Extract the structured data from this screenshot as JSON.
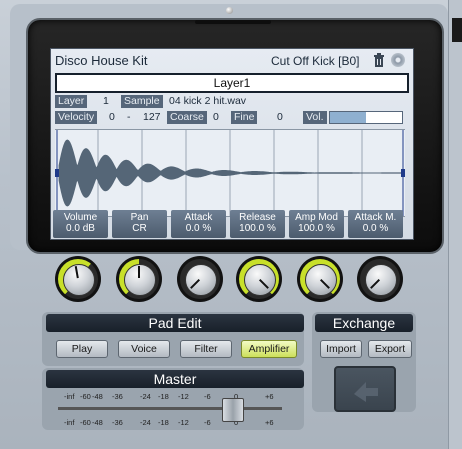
{
  "lcd": {
    "kit_name": "Disco House Kit",
    "preset_name": "Cut Off Kick [B0]",
    "layer_title": "Layer1",
    "layer_label": "Layer",
    "layer_value": "1",
    "sample_label": "Sample",
    "sample_value": "04 kick 2 hit.wav",
    "velocity_label": "Velocity",
    "velocity_low": "0",
    "velocity_dash": "-",
    "velocity_high": "127",
    "coarse_label": "Coarse",
    "coarse_value": "0",
    "fine_label": "Fine",
    "fine_value": "0",
    "vol_label": "Vol.",
    "vol_level": 0.5
  },
  "params": [
    {
      "name": "Volume",
      "value": "0.0 dB"
    },
    {
      "name": "Pan",
      "value": "CR"
    },
    {
      "name": "Attack",
      "value": "0.0 %"
    },
    {
      "name": "Release",
      "value": "100.0 %"
    },
    {
      "name": "Amp Mod",
      "value": "100.0 %"
    },
    {
      "name": "Attack M.",
      "value": "0.0 %"
    }
  ],
  "pad_edit": {
    "title": "Pad Edit",
    "buttons": [
      "Play",
      "Voice",
      "Filter",
      "Amplifier"
    ],
    "active": "Amplifier"
  },
  "exchange": {
    "title": "Exchange",
    "import_label": "Import",
    "export_label": "Export"
  },
  "master": {
    "title": "Master",
    "scale_top": [
      "-inf",
      "-60",
      "-48",
      "-36",
      "-24",
      "-18",
      "-12",
      "-6",
      "0",
      "+6"
    ],
    "scale_bottom": [
      "-inf",
      "-60",
      "-48",
      "-36",
      "-24",
      "-18",
      "-12",
      "-6",
      "0",
      "+6"
    ]
  },
  "colors": {
    "accent": "#c8e02a",
    "lcd_bg": "#e6ebf2",
    "tag_bg": "#56667a"
  }
}
